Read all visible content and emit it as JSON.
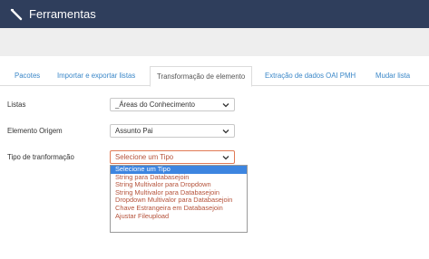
{
  "header": {
    "title": "Ferramentas",
    "icon": "wrench-icon",
    "bg_color": "#2f3e5c"
  },
  "tabs": [
    {
      "label": "Pacotes"
    },
    {
      "label": "Importar e exportar listas"
    },
    {
      "label": "Transformação de elemento",
      "active": true
    },
    {
      "label": "Extração de dados OAI PMH"
    },
    {
      "label": "Mudar lista"
    }
  ],
  "form": {
    "listas": {
      "label": "Listas",
      "value": "_Áreas do Conhecimento"
    },
    "elemento_origem": {
      "label": "Elemento Origem",
      "value": "Assunto Pai"
    },
    "tipo": {
      "label": "Tipo de tranformação",
      "value": "Selecione um Tipo"
    }
  },
  "dropdown_options": [
    "Selecione um Tipo",
    "String para Databasejoin",
    "String Multivalor para Dropdown",
    "String Multivalor para Databasejoin",
    "Dropdown Multivalor para Databasejoin",
    "Chave Estrangeira em Databasejoin",
    "Ajustar Fileupload"
  ]
}
